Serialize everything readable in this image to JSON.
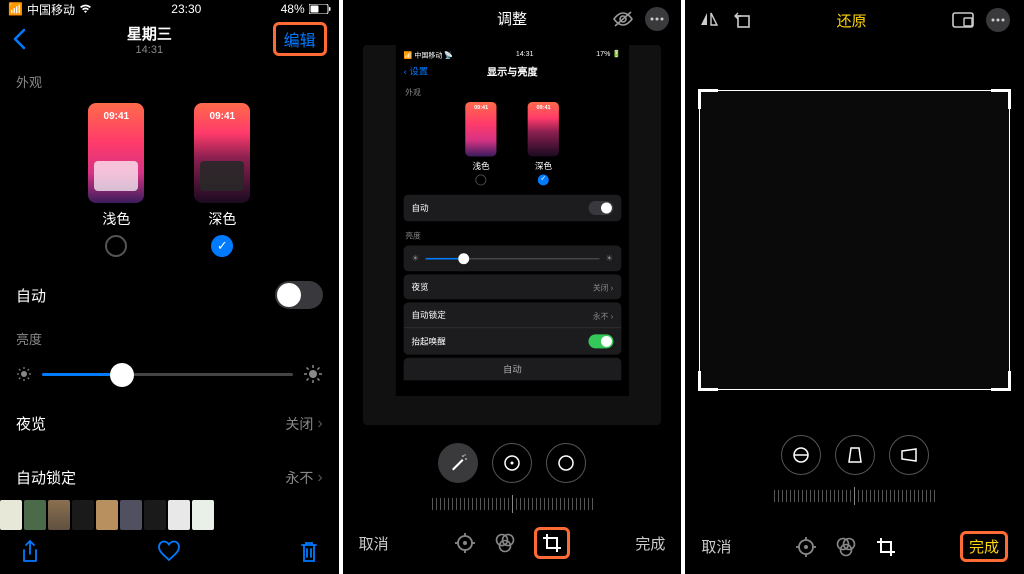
{
  "panel1": {
    "status": {
      "carrier": "中国移动",
      "time": "23:30",
      "battery": "48%"
    },
    "header": {
      "day": "星期三",
      "time": "14:31",
      "edit": "编辑"
    },
    "appearance": {
      "section_label": "外观",
      "light": "浅色",
      "dark": "深色",
      "mockup_time": "09:41",
      "selected": "dark"
    },
    "auto_row": "自动",
    "brightness": {
      "section_label": "亮度",
      "value_pct": 32
    },
    "night_shift": {
      "label": "夜览",
      "value": "关闭"
    },
    "auto_lock": {
      "label": "自动锁定",
      "value": "永不"
    }
  },
  "panel2": {
    "header_title": "调整",
    "preview": {
      "status": {
        "carrier": "中国移动",
        "time": "14:31",
        "battery": "17%"
      },
      "back_label": "设置",
      "title": "显示与亮度",
      "appearance_label": "外观",
      "light": "浅色",
      "dark": "深色",
      "mockup_time": "09:41",
      "auto": "自动",
      "brightness_label": "亮度",
      "night_shift": {
        "label": "夜览",
        "value": "关闭"
      },
      "auto_lock": {
        "label": "自动锁定",
        "value": "永不"
      },
      "raise_to_wake": "抬起唤醒",
      "auto_center": "自动"
    },
    "bottom": {
      "cancel": "取消",
      "done": "完成"
    }
  },
  "panel3": {
    "header_center": "还原",
    "bottom": {
      "cancel": "取消",
      "done": "完成"
    }
  }
}
